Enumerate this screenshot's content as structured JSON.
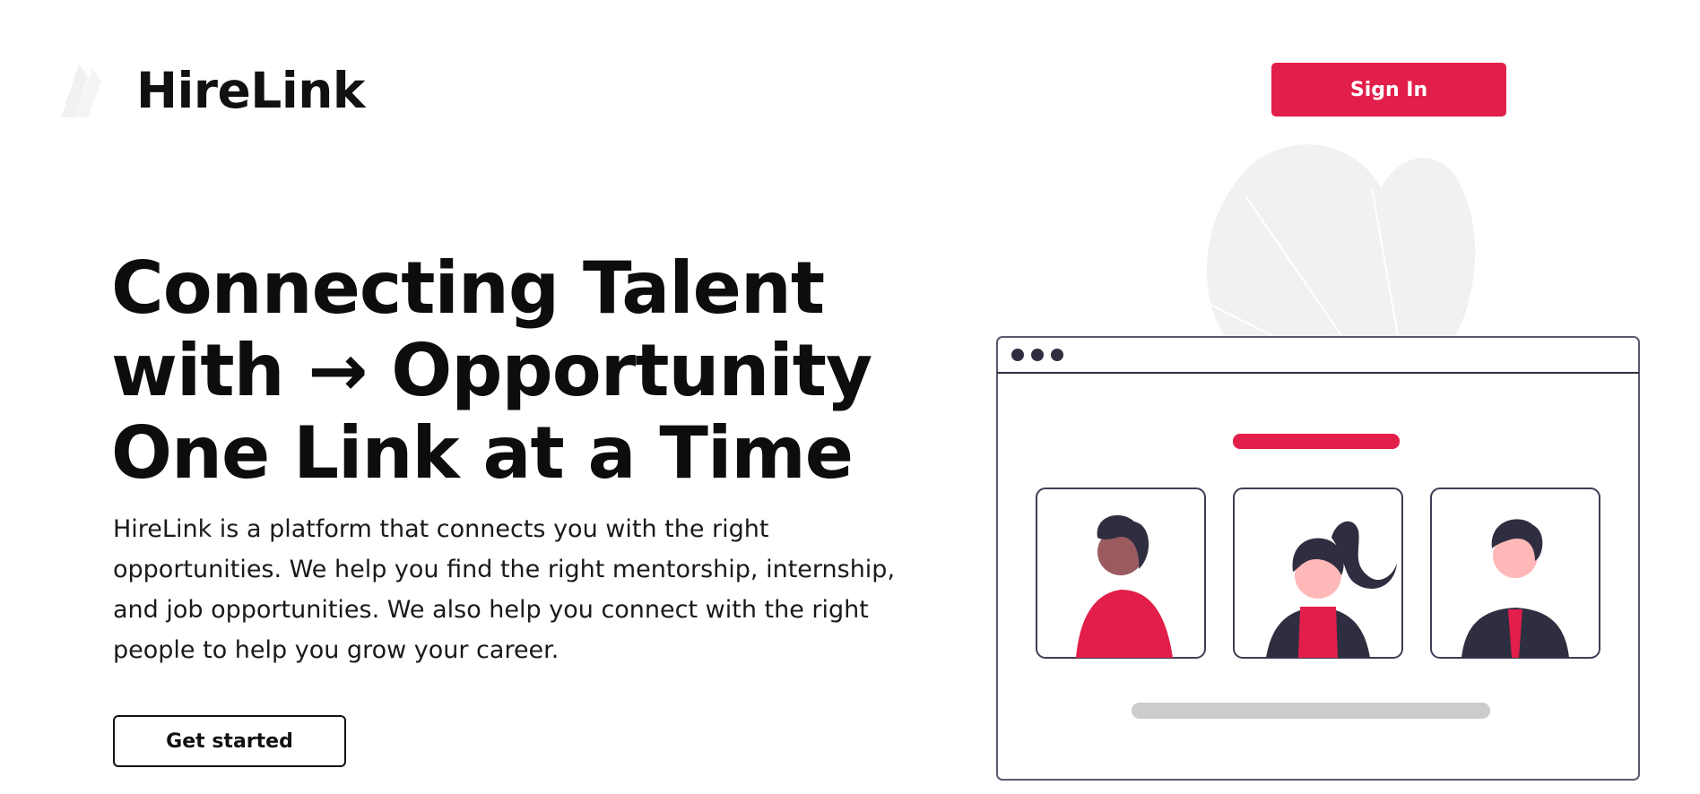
{
  "header": {
    "brand": "HireLink",
    "signin_label": "Sign In"
  },
  "hero": {
    "title_lines": [
      "Connecting Talent",
      "with → Opportunity",
      "One Link at a Time"
    ],
    "description": "HireLink is a platform that connects you with the right opportunities. We help you find the right mentorship, internship, and job opportunities. We also help you connect with the right people to help you grow your career.",
    "cta_label": "Get started"
  },
  "colors": {
    "accent": "#e21e4a",
    "dark": "#2f2e41",
    "text": "#0d0d0d"
  },
  "icons": {
    "logo": "hirelink-logo-icon",
    "illustration": "video-call-illustration"
  }
}
